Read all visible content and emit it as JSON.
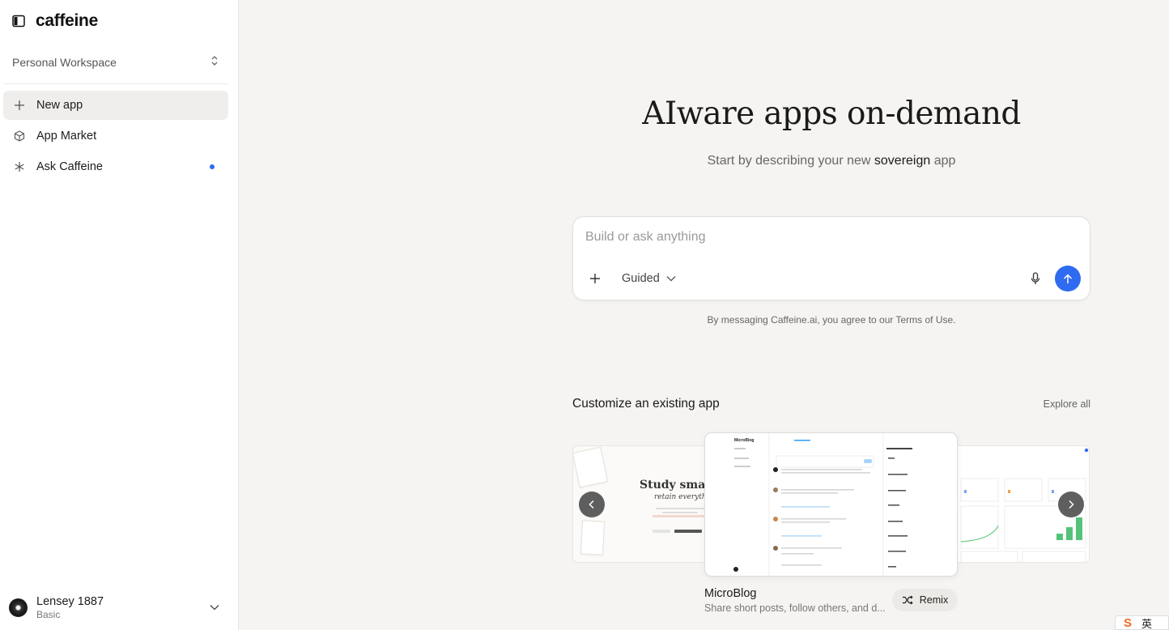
{
  "sidebar": {
    "brand": "caffeine",
    "workspace": "Personal Workspace",
    "nav": [
      {
        "label": "New app",
        "icon": "plus-icon",
        "active": true
      },
      {
        "label": "App Market",
        "icon": "cube-icon",
        "active": false
      },
      {
        "label": "Ask Caffeine",
        "icon": "asterisk-icon",
        "active": false,
        "badge": "dot"
      }
    ],
    "user": {
      "name": "Lensey 1887",
      "plan": "Basic"
    }
  },
  "hero": {
    "title": "AIware apps on-demand",
    "subtitle_before": "Start by describing your new ",
    "subtitle_emphasis": "sovereign",
    "subtitle_after": " app"
  },
  "composer": {
    "placeholder": "Build or ask anything",
    "value": "",
    "mode": "Guided"
  },
  "terms": "By messaging Caffeine.ai, you agree to our Terms of Use.",
  "templates": {
    "section_title": "Customize an existing app",
    "explore_label": "Explore all",
    "side_left_title": "Study smarter",
    "side_left_subtitle": "retain everything",
    "featured": {
      "name": "MicroBlog",
      "description": "Share short posts, follow others, and d...",
      "remix_label": "Remix",
      "preview_title": "MicroBlog"
    }
  },
  "ime": {
    "logo": "S",
    "lang": "英"
  },
  "colors": {
    "accent": "#2f6bf0",
    "background": "#f5f4f2",
    "sidebar": "#ffffff"
  }
}
